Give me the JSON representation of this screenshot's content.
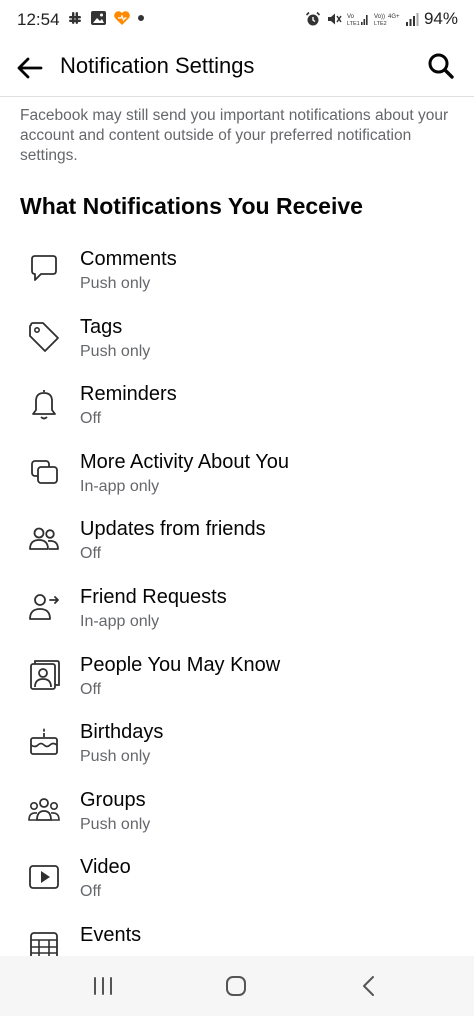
{
  "status_bar": {
    "time": "12:54",
    "battery": "94%"
  },
  "header": {
    "title": "Notification Settings"
  },
  "notice": "Facebook may still send you important notifications about your account and content outside of your preferred notification settings.",
  "section_title": "What Notifications You Receive",
  "items": [
    {
      "label": "Comments",
      "value": "Push only",
      "icon": "comment-icon"
    },
    {
      "label": "Tags",
      "value": "Push only",
      "icon": "tag-icon"
    },
    {
      "label": "Reminders",
      "value": "Off",
      "icon": "bell-icon"
    },
    {
      "label": "More Activity About You",
      "value": "In-app only",
      "icon": "activity-icon"
    },
    {
      "label": "Updates from friends",
      "value": "Off",
      "icon": "friends-icon"
    },
    {
      "label": "Friend Requests",
      "value": "In-app only",
      "icon": "friend-request-icon"
    },
    {
      "label": "People You May Know",
      "value": "Off",
      "icon": "people-you-may-know-icon"
    },
    {
      "label": "Birthdays",
      "value": "Push only",
      "icon": "birthday-cake-icon"
    },
    {
      "label": "Groups",
      "value": "Push only",
      "icon": "groups-icon"
    },
    {
      "label": "Video",
      "value": "Off",
      "icon": "video-play-icon"
    },
    {
      "label": "Events",
      "value": "",
      "icon": "calendar-icon"
    }
  ]
}
